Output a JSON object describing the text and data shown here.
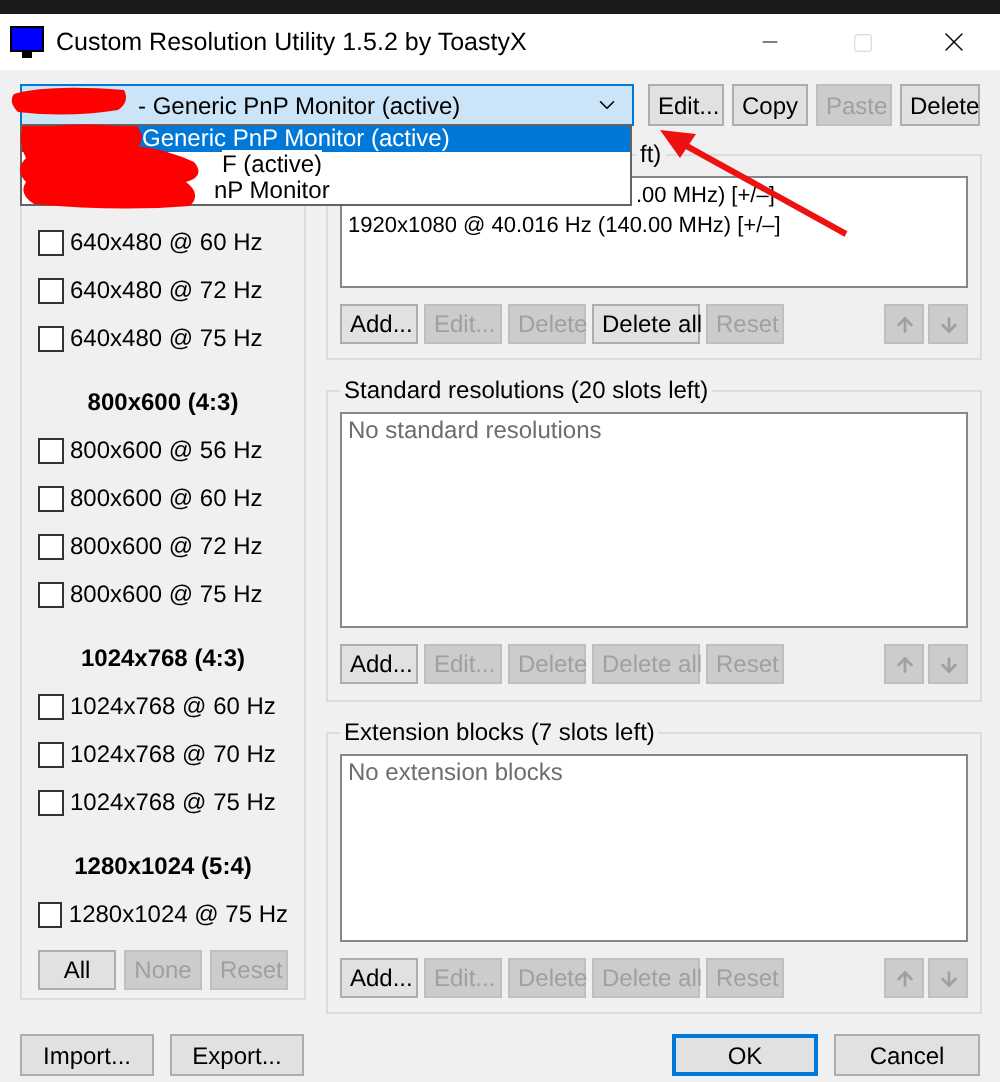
{
  "window": {
    "title": "Custom Resolution Utility 1.5.2 by ToastyX",
    "maximize_disabled": true
  },
  "monitor_select": {
    "value": "- Generic PnP Monitor (active)",
    "expanded": true,
    "options": [
      {
        "label": "Generic PnP Monitor (active)",
        "selected": true
      },
      {
        "label": "F (active)",
        "selected": false
      },
      {
        "label": "nP Monitor",
        "selected": false
      }
    ]
  },
  "top_buttons": [
    {
      "label": "Edit...",
      "disabled": false
    },
    {
      "label": "Copy",
      "disabled": false
    },
    {
      "label": "Paste",
      "disabled": true
    },
    {
      "label": "Delete",
      "disabled": false
    }
  ],
  "established_resolutions": {
    "groups": [
      {
        "items": [
          {
            "label": "640x480 @ 60 Hz",
            "checked": false
          },
          {
            "label": "640x480 @ 72 Hz",
            "checked": false
          },
          {
            "label": "640x480 @ 75 Hz",
            "checked": false
          }
        ]
      },
      {
        "heading": "800x600 (4:3)",
        "items": [
          {
            "label": "800x600 @ 56 Hz",
            "checked": false
          },
          {
            "label": "800x600 @ 60 Hz",
            "checked": false
          },
          {
            "label": "800x600 @ 72 Hz",
            "checked": false
          },
          {
            "label": "800x600 @ 75 Hz",
            "checked": false
          }
        ]
      },
      {
        "heading": "1024x768 (4:3)",
        "items": [
          {
            "label": "1024x768 @ 60 Hz",
            "checked": false
          },
          {
            "label": "1024x768 @ 70 Hz",
            "checked": false
          },
          {
            "label": "1024x768 @ 75 Hz",
            "checked": false
          }
        ]
      },
      {
        "heading": "1280x1024 (5:4)",
        "items": [
          {
            "label": "1280x1024 @ 75 Hz",
            "checked": false
          }
        ]
      }
    ],
    "buttons": [
      {
        "label": "All",
        "disabled": false
      },
      {
        "label": "None",
        "disabled": true
      },
      {
        "label": "Reset",
        "disabled": true
      }
    ]
  },
  "resolution_groups": [
    {
      "legend": "ft)",
      "rows": [
        ".00 MHz) [+/–]",
        "1920x1080 @ 40.016 Hz (140.00 MHz) [+/–]"
      ],
      "buttons": [
        {
          "label": "Add...",
          "disabled": false
        },
        {
          "label": "Edit...",
          "disabled": true
        },
        {
          "label": "Delete",
          "disabled": true
        },
        {
          "label": "Delete all",
          "disabled": false
        },
        {
          "label": "Reset",
          "disabled": true
        }
      ],
      "move_buttons": [
        {
          "kind": "up",
          "disabled": true
        },
        {
          "kind": "down",
          "disabled": true
        }
      ]
    },
    {
      "legend": "Standard resolutions (20 slots left)",
      "empty_text": "No standard resolutions",
      "buttons": [
        {
          "label": "Add...",
          "disabled": false
        },
        {
          "label": "Edit...",
          "disabled": true
        },
        {
          "label": "Delete",
          "disabled": true
        },
        {
          "label": "Delete all",
          "disabled": true
        },
        {
          "label": "Reset",
          "disabled": true
        }
      ],
      "move_buttons": [
        {
          "kind": "up",
          "disabled": true
        },
        {
          "kind": "down",
          "disabled": true
        }
      ]
    },
    {
      "legend": "Extension blocks (7 slots left)",
      "empty_text": "No extension blocks",
      "buttons": [
        {
          "label": "Add...",
          "disabled": false
        },
        {
          "label": "Edit...",
          "disabled": true
        },
        {
          "label": "Delete",
          "disabled": true
        },
        {
          "label": "Delete all",
          "disabled": true
        },
        {
          "label": "Reset",
          "disabled": true
        }
      ],
      "move_buttons": [
        {
          "kind": "up",
          "disabled": true
        },
        {
          "kind": "down",
          "disabled": true
        }
      ]
    }
  ],
  "bottom_buttons": [
    {
      "label": "Import...",
      "kind": "normal"
    },
    {
      "label": "Export...",
      "kind": "normal"
    },
    {
      "label": "OK",
      "kind": "default"
    },
    {
      "label": "Cancel",
      "kind": "normal"
    }
  ]
}
